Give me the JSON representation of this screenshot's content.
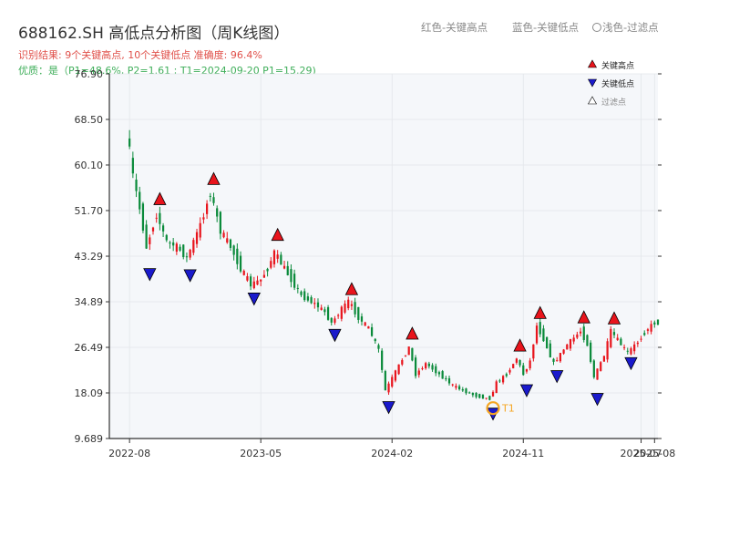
{
  "header": {
    "title": "688162.SH 高低点分析图（周K线图）",
    "result_line": "识别结果: 9个关键高点, 10个关键低点  准确度: 96.4%",
    "quality_line": "优质：是（P1=48.6%, P2=1.61 ; T1=2024-09-20 P1=15.29)",
    "legend_red": "红色-关键高点",
    "legend_blue": "蓝色-关键低点",
    "legend_hollow": "浅色-过滤点"
  },
  "colors": {
    "up": "#e8141c",
    "down": "#0a8a3a",
    "high_marker": "#e8141c",
    "low_marker": "#1a1acc",
    "t1_marker": "#f5a623",
    "plot_bg": "#f5f7fa"
  },
  "chart_data": {
    "type": "candlestick",
    "title": "688162.SH 高低点分析图（周K线图）",
    "y_ticks": [
      9.689,
      18.09,
      26.49,
      34.89,
      43.29,
      51.7,
      60.1,
      68.5,
      76.9
    ],
    "y_tick_labels": [
      "9.689",
      "18.09",
      "26.49",
      "34.89",
      "43.29",
      "51.70",
      "60.10",
      "68.50",
      "76.90"
    ],
    "ylim": [
      9.689,
      76.9
    ],
    "x_ticks": [
      {
        "label": "2022-08",
        "week": 0
      },
      {
        "label": "2023-05",
        "week": 39
      },
      {
        "label": "2024-02",
        "week": 78
      },
      {
        "label": "2024-11",
        "week": 117
      },
      {
        "label": "2025-07",
        "week": 152
      },
      {
        "label": "2025-08",
        "week": 156
      }
    ],
    "xlim_weeks": [
      -6,
      157
    ],
    "grid": true,
    "key_points": [
      {
        "type": "low",
        "week": 6,
        "price": 41.0
      },
      {
        "type": "high",
        "week": 9,
        "price": 52.8
      },
      {
        "type": "low",
        "week": 18,
        "price": 40.8
      },
      {
        "type": "high",
        "week": 25,
        "price": 56.5
      },
      {
        "type": "low",
        "week": 37,
        "price": 36.5
      },
      {
        "type": "high",
        "week": 44,
        "price": 46.2
      },
      {
        "type": "low",
        "week": 61,
        "price": 29.8
      },
      {
        "type": "high",
        "week": 66,
        "price": 36.2
      },
      {
        "type": "low",
        "week": 77,
        "price": 16.5
      },
      {
        "type": "high",
        "week": 84,
        "price": 28.0
      },
      {
        "type": "low",
        "week": 108,
        "price": 15.29
      },
      {
        "type": "high",
        "week": 116,
        "price": 25.8
      },
      {
        "type": "low",
        "week": 118,
        "price": 19.6
      },
      {
        "type": "high",
        "week": 122,
        "price": 31.8
      },
      {
        "type": "low",
        "week": 127,
        "price": 22.2
      },
      {
        "type": "high",
        "week": 135,
        "price": 31.0
      },
      {
        "type": "low",
        "week": 139,
        "price": 18.0
      },
      {
        "type": "high",
        "week": 144,
        "price": 30.8
      },
      {
        "type": "low",
        "week": 149,
        "price": 24.6
      }
    ],
    "t1_marker": {
      "label": "T1",
      "week": 108,
      "price": 15.29
    },
    "legend": [
      "关键高点",
      "关键低点",
      "过滤点"
    ],
    "legend_position": "top-right",
    "price_path": [
      [
        0,
        67.0
      ],
      [
        2,
        58.0
      ],
      [
        4,
        52.0
      ],
      [
        6,
        45.0
      ],
      [
        9,
        51.0
      ],
      [
        12,
        46.0
      ],
      [
        15,
        45.0
      ],
      [
        18,
        43.0
      ],
      [
        22,
        49.0
      ],
      [
        25,
        55.0
      ],
      [
        28,
        48.0
      ],
      [
        31,
        45.0
      ],
      [
        34,
        41.0
      ],
      [
        37,
        38.0
      ],
      [
        40,
        39.0
      ],
      [
        42,
        41.0
      ],
      [
        44,
        44.0
      ],
      [
        48,
        40.0
      ],
      [
        52,
        36.0
      ],
      [
        56,
        34.5
      ],
      [
        59,
        33.0
      ],
      [
        61,
        31.0
      ],
      [
        64,
        33.5
      ],
      [
        66,
        35.0
      ],
      [
        69,
        32.0
      ],
      [
        72,
        30.0
      ],
      [
        75,
        26.0
      ],
      [
        77,
        18.5
      ],
      [
        80,
        22.0
      ],
      [
        84,
        26.5
      ],
      [
        86,
        21.5
      ],
      [
        89,
        23.5
      ],
      [
        93,
        21.5
      ],
      [
        97,
        19.5
      ],
      [
        100,
        18.5
      ],
      [
        104,
        17.5
      ],
      [
        108,
        17.0
      ],
      [
        110,
        20.0
      ],
      [
        113,
        21.5
      ],
      [
        116,
        24.5
      ],
      [
        118,
        21.5
      ],
      [
        120,
        24.0
      ],
      [
        122,
        30.5
      ],
      [
        124,
        28.0
      ],
      [
        127,
        23.5
      ],
      [
        131,
        27.0
      ],
      [
        135,
        29.5
      ],
      [
        137,
        27.0
      ],
      [
        139,
        21.0
      ],
      [
        142,
        25.0
      ],
      [
        144,
        29.5
      ],
      [
        147,
        27.0
      ],
      [
        149,
        25.5
      ],
      [
        152,
        27.5
      ],
      [
        155,
        30.0
      ],
      [
        157,
        31.0
      ]
    ]
  }
}
